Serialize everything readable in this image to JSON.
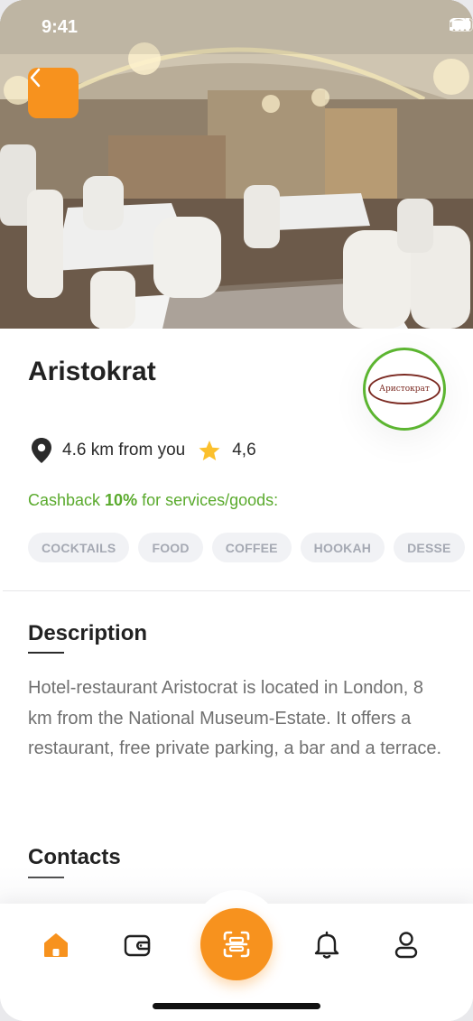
{
  "status_bar": {
    "time": "9:41"
  },
  "venue": {
    "name": "Aristokrat",
    "logo_text": "Аристократ",
    "distance": "4.6 km from you",
    "rating": "4,6"
  },
  "cashback": {
    "prefix": "Cashback ",
    "percent": "10%",
    "suffix": " for services/goods:"
  },
  "tags": [
    "COCKTAILS",
    "FOOD",
    "COFFEE",
    "HOOKAH",
    "DESSE"
  ],
  "description": {
    "title": "Description",
    "text": "Hotel-restaurant Aristocrat is located in London, 8 km from the National Museum-Estate. It offers a restaurant, free private parking, a bar and a terrace."
  },
  "contacts": {
    "title": "Contacts"
  },
  "colors": {
    "accent": "#f7921e",
    "cashback_green": "#5aaa2d",
    "logo_ring": "#5cb531",
    "rating_star": "#fbc02d"
  },
  "nav": {
    "items": [
      {
        "icon": "home-icon",
        "active": true
      },
      {
        "icon": "wallet-icon",
        "active": false
      },
      {
        "icon": "scan-icon",
        "active": false
      },
      {
        "icon": "bell-icon",
        "active": false
      },
      {
        "icon": "profile-icon",
        "active": false
      }
    ]
  }
}
